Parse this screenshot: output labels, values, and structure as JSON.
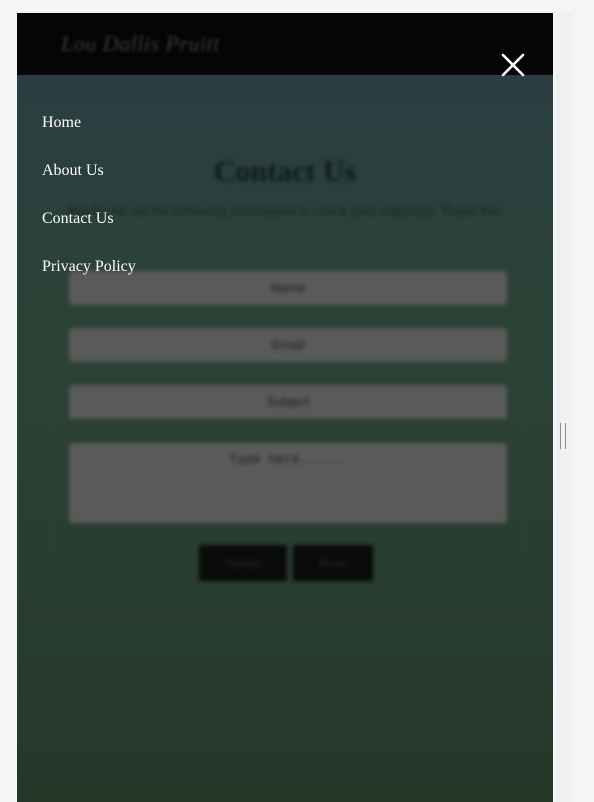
{
  "header": {
    "site_title": "Lou Dallis Pruitt"
  },
  "overlay_menu": {
    "close_icon": "close-icon",
    "items": [
      {
        "label": "Home"
      },
      {
        "label": "About Us"
      },
      {
        "label": "Contact Us"
      },
      {
        "label": "Privacy Policy"
      }
    ]
  },
  "page": {
    "heading": "Contact Us",
    "subtext": "Kindly fill out the following information to check your eligibility. Thank You",
    "form": {
      "name_placeholder": "Name",
      "email_placeholder": "Email",
      "subject_placeholder": "Subject",
      "message_placeholder": "Type here......",
      "submit_label": "Submit",
      "reset_label": "Reset"
    }
  },
  "colors": {
    "menu_text": "#ffffff",
    "topbar": "#050505",
    "background_top": "#2a3d44",
    "background_bottom": "#24382a"
  }
}
